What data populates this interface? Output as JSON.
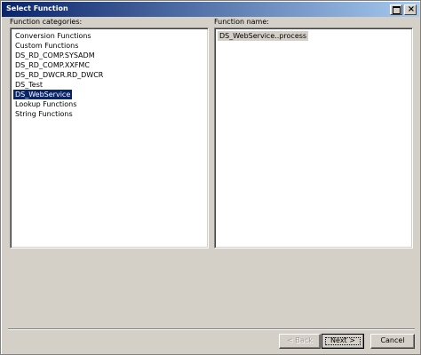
{
  "window": {
    "title": "Select Function"
  },
  "categories": {
    "label": "Function categories:",
    "items": [
      "Conversion Functions",
      "Custom Functions",
      "DS_RD_COMP.SYSADM",
      "DS_RD_COMP.XXFMC",
      "DS_RD_DWCR.RD_DWCR",
      "DS_Test",
      "DS_WebService",
      "Lookup Functions",
      "String Functions"
    ],
    "selected_index": 6
  },
  "functions": {
    "label": "Function name:",
    "items": [
      "DS_WebService..process"
    ],
    "selected_index": 0
  },
  "buttons": {
    "back": "< Back",
    "next": "Next >",
    "cancel": "Cancel"
  }
}
